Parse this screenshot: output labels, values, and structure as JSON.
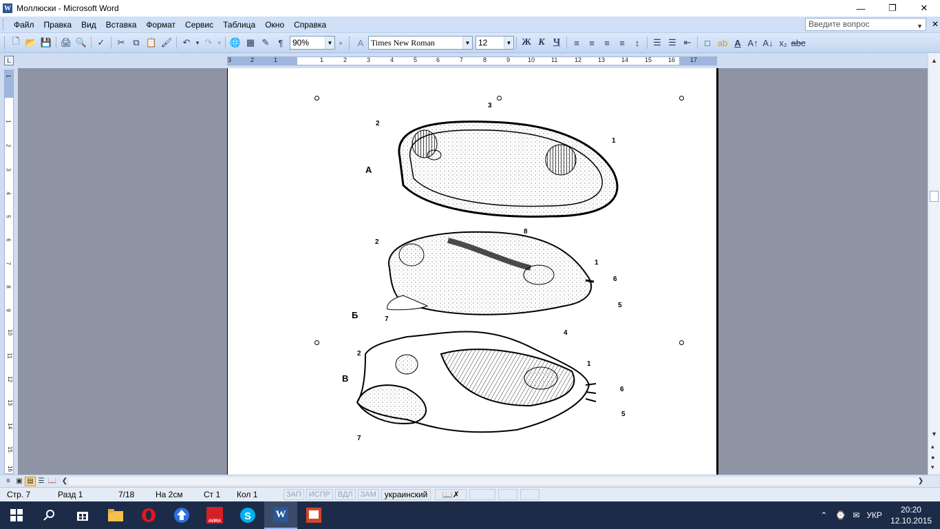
{
  "window": {
    "title": "Моллюски - Microsoft Word",
    "app_icon": "W"
  },
  "menu": {
    "items": [
      "Файл",
      "Правка",
      "Вид",
      "Вставка",
      "Формат",
      "Сервис",
      "Таблица",
      "Окно",
      "Справка"
    ],
    "help_placeholder": "Введите вопрос"
  },
  "toolbar": {
    "zoom": "90%",
    "font_name": "Times New Roman",
    "font_size": "12",
    "bold_label": "Ж",
    "italic_label": "К",
    "underline_label": "Ч",
    "pilcrow": "¶"
  },
  "ruler": {
    "h_numbers": [
      "3",
      "2",
      "1",
      "1",
      "2",
      "3",
      "4",
      "5",
      "6",
      "7",
      "8",
      "9",
      "10",
      "11",
      "12",
      "13",
      "14",
      "15",
      "16",
      "17"
    ],
    "v_numbers": [
      "1",
      "1",
      "2",
      "3",
      "4",
      "5",
      "6",
      "7",
      "8",
      "9",
      "10",
      "11",
      "12",
      "13",
      "14",
      "15",
      "16"
    ]
  },
  "figure": {
    "labels": {
      "A": "А",
      "B": "Б",
      "V": "В",
      "n1": "1",
      "n2": "2",
      "n3": "3",
      "n4": "4",
      "n5": "5",
      "n6": "6",
      "n7": "7",
      "n8": "8"
    }
  },
  "status": {
    "page": "Стр. 7",
    "section": "Разд 1",
    "page_of": "7/18",
    "at": "На  2см",
    "line": "Ст  1",
    "col": "Кол  1",
    "rec": "ЗАП",
    "trk": "ИСПР",
    "ext": "ВДЛ",
    "ovr": "ЗАМ",
    "language": "украинский"
  },
  "taskbar": {
    "apps": [
      "start-icon",
      "search-icon",
      "store-icon",
      "file-explorer-icon",
      "opera-icon",
      "upload-app-icon",
      "avira-icon",
      "skype-icon",
      "word-icon",
      "powerpoint-icon"
    ],
    "avira_label": "AVIRA",
    "lang": "УКР",
    "time": "20:20",
    "date": "12.10.2015"
  },
  "colors": {
    "menubar": "#cfe0f7",
    "doc_background": "#8e94a4",
    "taskbar": "#1c2b48",
    "word_blue": "#2b579a"
  }
}
